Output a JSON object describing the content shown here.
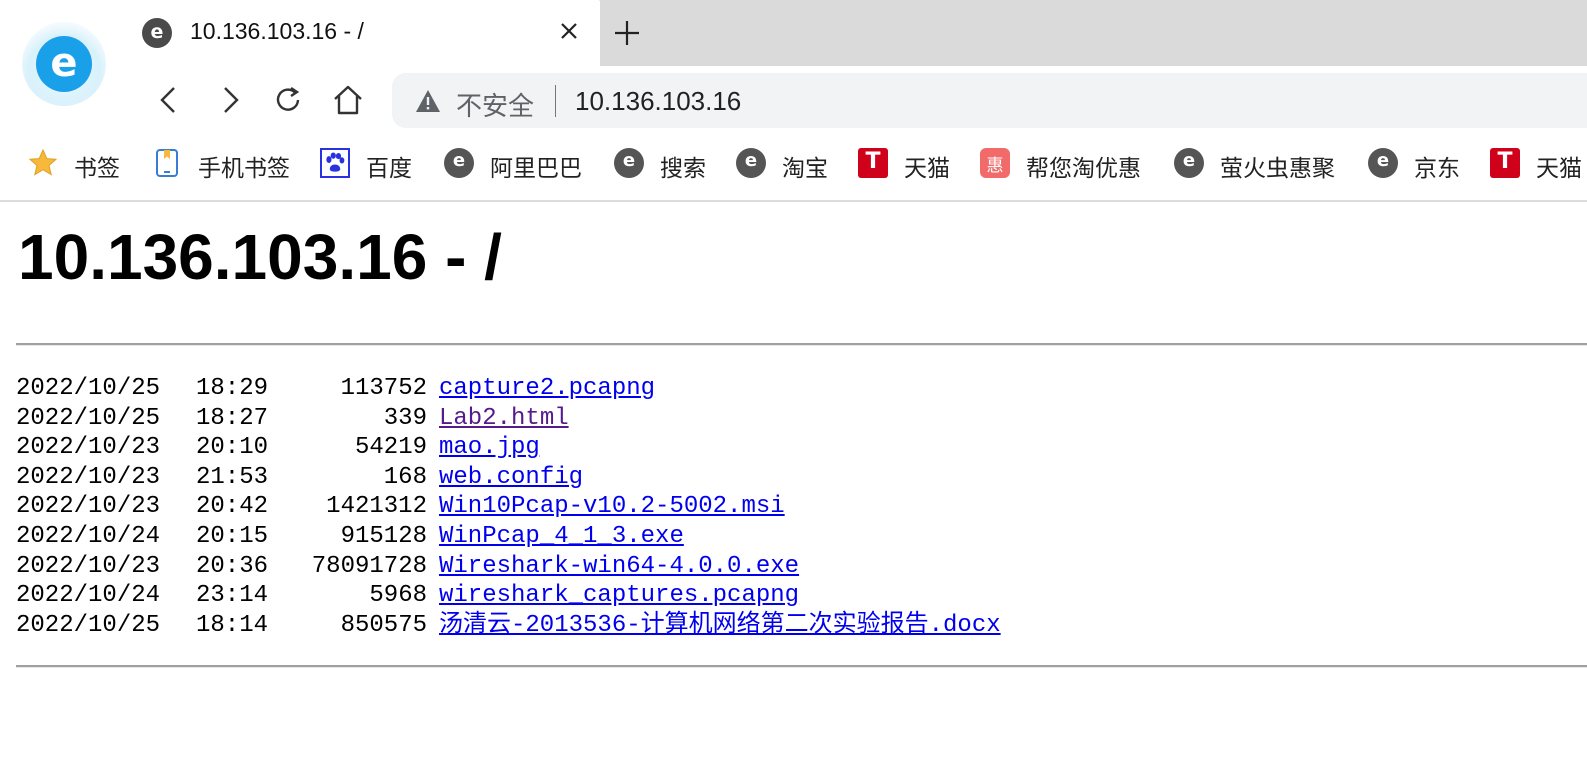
{
  "tab": {
    "title": "10.136.103.16 - /"
  },
  "omnibox": {
    "security_label": "不安全",
    "url": "10.136.103.16"
  },
  "bookmarks": [
    {
      "label": "书签",
      "icon": "star-icon"
    },
    {
      "label": "手机书签",
      "icon": "mobile-bookmark-icon"
    },
    {
      "label": "百度",
      "icon": "baidu-paw-icon"
    },
    {
      "label": "阿里巴巴",
      "icon": "browser-e-icon"
    },
    {
      "label": "搜索",
      "icon": "browser-e-icon"
    },
    {
      "label": "淘宝",
      "icon": "browser-e-icon"
    },
    {
      "label": "天猫",
      "icon": "tmall-t-icon"
    },
    {
      "label": "帮您淘优惠",
      "icon": "hui-icon"
    },
    {
      "label": "萤火虫惠聚",
      "icon": "browser-e-icon"
    },
    {
      "label": "京东",
      "icon": "browser-e-icon"
    },
    {
      "label": "天猫",
      "icon": "tmall-t-icon"
    }
  ],
  "icon_glyphs": {
    "tmall": "T",
    "hui": "惠"
  },
  "page": {
    "heading": "10.136.103.16 - /",
    "files": [
      {
        "date": "2022/10/25",
        "time": "18:29",
        "size": "113752",
        "name": "capture2.pcapng",
        "visited": false
      },
      {
        "date": "2022/10/25",
        "time": "18:27",
        "size": "339",
        "name": "Lab2.html",
        "visited": true
      },
      {
        "date": "2022/10/23",
        "time": "20:10",
        "size": "54219",
        "name": "mao.jpg",
        "visited": false
      },
      {
        "date": "2022/10/23",
        "time": "21:53",
        "size": "168",
        "name": "web.config",
        "visited": false
      },
      {
        "date": "2022/10/23",
        "time": "20:42",
        "size": "1421312",
        "name": "Win10Pcap-v10.2-5002.msi",
        "visited": false
      },
      {
        "date": "2022/10/24",
        "time": "20:15",
        "size": "915128",
        "name": "WinPcap_4_1_3.exe",
        "visited": false
      },
      {
        "date": "2022/10/23",
        "time": "20:36",
        "size": "78091728",
        "name": "Wireshark-win64-4.0.0.exe",
        "visited": false
      },
      {
        "date": "2022/10/24",
        "time": "23:14",
        "size": "5968",
        "name": "wireshark_captures.pcapng",
        "visited": false
      },
      {
        "date": "2022/10/25",
        "time": "18:14",
        "size": "850575",
        "name": "汤清云-2013536-计算机网络第二次实验报告.docx",
        "visited": false
      }
    ]
  },
  "colors": {
    "link": "#0000ee",
    "visited_link": "#551a8b",
    "tab_strip": "#dadada",
    "omnibox_bg": "#f1f3f4"
  }
}
